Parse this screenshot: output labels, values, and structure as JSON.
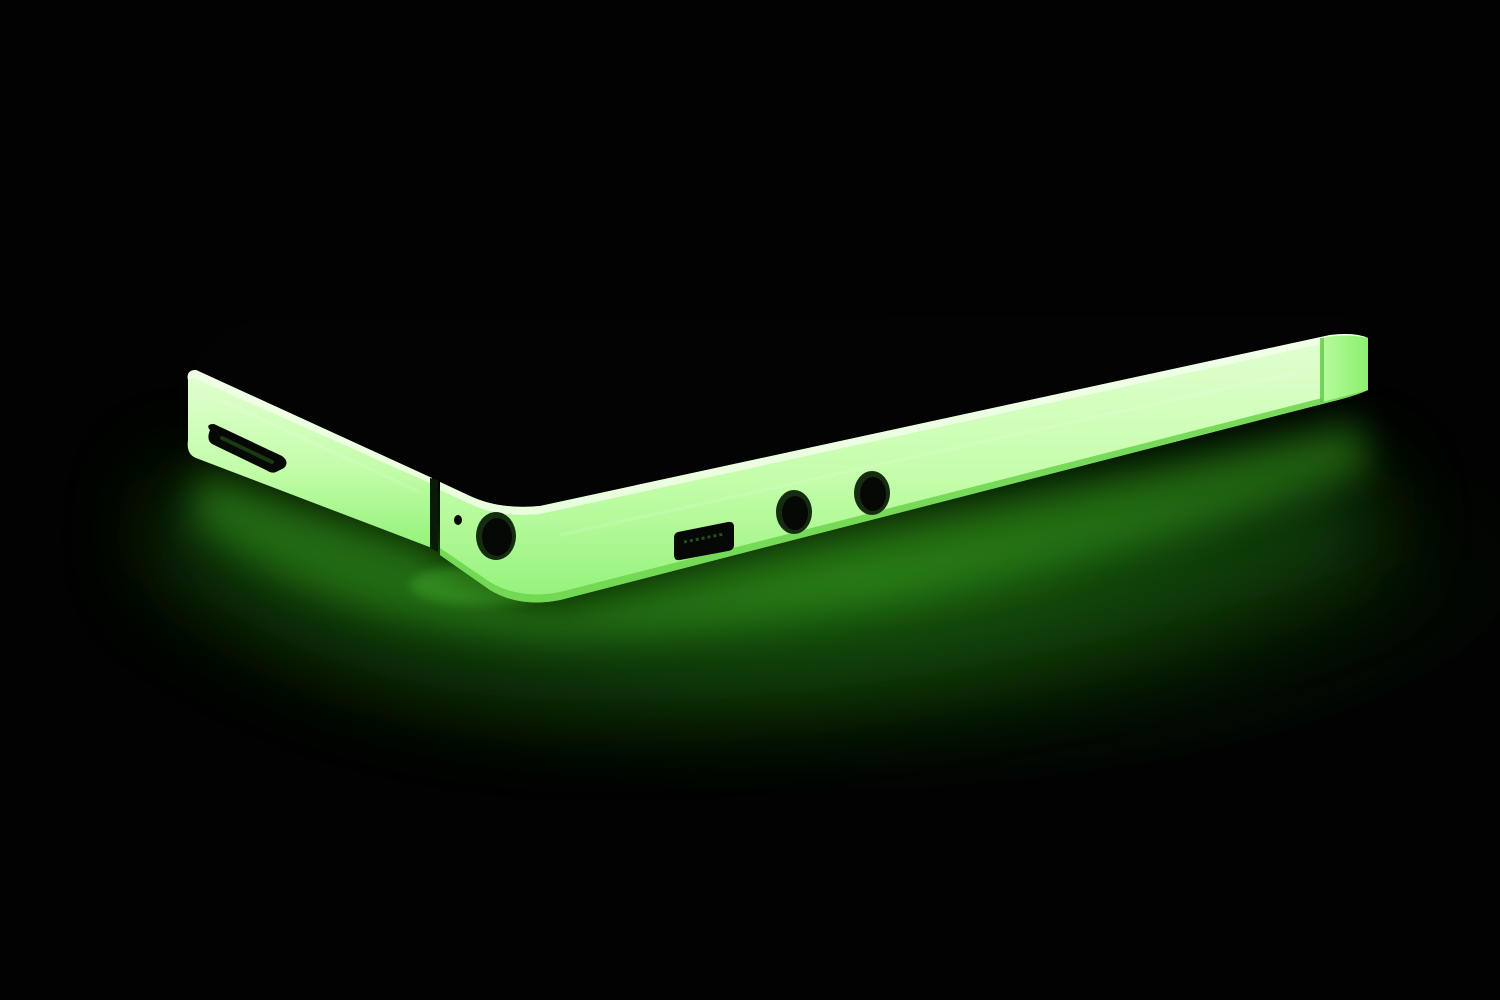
{
  "scene": {
    "subject": "phone-edge-with-glow-bumper",
    "colors": {
      "background": "#010201",
      "glow": "#3fa51f",
      "glow_bright": "#7dff5a",
      "bumper_face": "#cfffb8",
      "bumper_face_mid": "#9cfa84",
      "bumper_shadow": "#5bd23f",
      "hole": "#050805",
      "phone_body": "#020302"
    },
    "icons": [
      "usb-port-icon",
      "microphone-hole-icon",
      "headphone-jack-icon",
      "lightning-port-icon",
      "speaker-hole-icon"
    ]
  }
}
